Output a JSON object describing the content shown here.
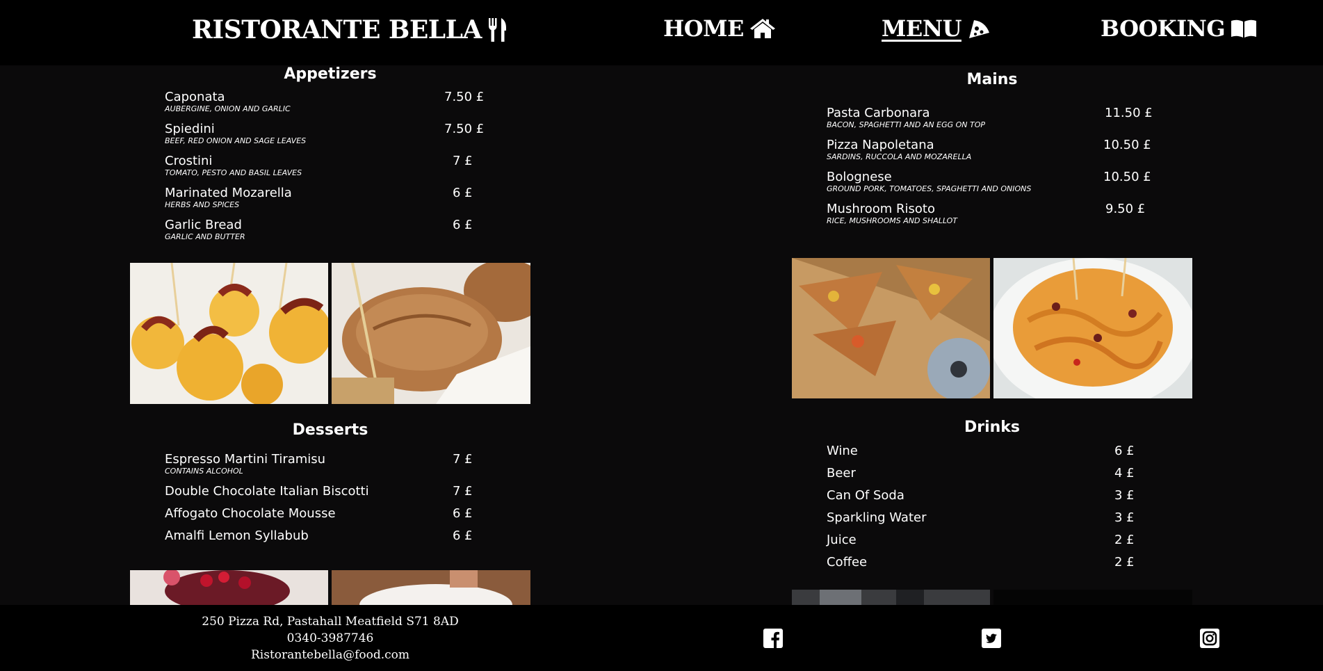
{
  "header": {
    "brand": "RISTORANTE BELLA",
    "nav": {
      "home": "HOME",
      "menu": "MENU",
      "booking": "BOOKING"
    }
  },
  "appetizers": {
    "title": "Appetizers",
    "items": [
      {
        "name": "Caponata",
        "desc": "Aubergine, onion and garlic",
        "price": "7.50 £"
      },
      {
        "name": "Spiedini",
        "desc": "Beef, red onion and sage leaves",
        "price": "7.50 £"
      },
      {
        "name": "Crostini",
        "desc": "Tomato, pesto and basil leaves",
        "price": "7 £"
      },
      {
        "name": "Marinated Mozarella",
        "desc": "Herbs and spices",
        "price": "6 £"
      },
      {
        "name": "Garlic Bread",
        "desc": "Garlic and butter",
        "price": "6 £"
      }
    ]
  },
  "desserts": {
    "title": "Desserts",
    "items": [
      {
        "name": "Espresso Martini Tiramisu",
        "desc": "Contains alcohol",
        "price": "7 £"
      },
      {
        "name": "Double Chocolate Italian Biscotti",
        "price": "7 £"
      },
      {
        "name": "Affogato Chocolate Mousse",
        "price": "6 £"
      },
      {
        "name": "Amalfi Lemon Syllabub",
        "price": "6 £"
      }
    ]
  },
  "mains": {
    "title": "Mains",
    "items": [
      {
        "name": "Pasta Carbonara",
        "desc": "Bacon, spaghetti and an egg on top",
        "price": "11.50 £"
      },
      {
        "name": "Pizza Napoletana",
        "desc": "Sardins, ruccola and mozarella",
        "price": "10.50 £"
      },
      {
        "name": "Bolognese",
        "desc": "Ground pork, tomatoes, spaghetti and onions",
        "price": "10.50 £"
      },
      {
        "name": "Mushroom Risoto",
        "desc": "Rice, mushrooms and shallot",
        "price": "9.50 £"
      }
    ]
  },
  "drinks": {
    "title": "Drinks",
    "items": [
      {
        "name": "Wine",
        "price": "6 £"
      },
      {
        "name": "Beer",
        "price": "4 £"
      },
      {
        "name": "Can Of Soda",
        "price": "3 £"
      },
      {
        "name": "Sparkling Water",
        "price": "3 £"
      },
      {
        "name": "Juice",
        "price": "2 £"
      },
      {
        "name": "Coffee",
        "price": "2 £"
      }
    ]
  },
  "footer": {
    "address": "250 Pizza Rd, Pastahall Meatfield S71 8AD",
    "phone": "0340-3987746",
    "email": "Ristorantebella@food.com",
    "social": [
      "facebook-icon",
      "twitter-icon",
      "instagram-icon"
    ]
  }
}
